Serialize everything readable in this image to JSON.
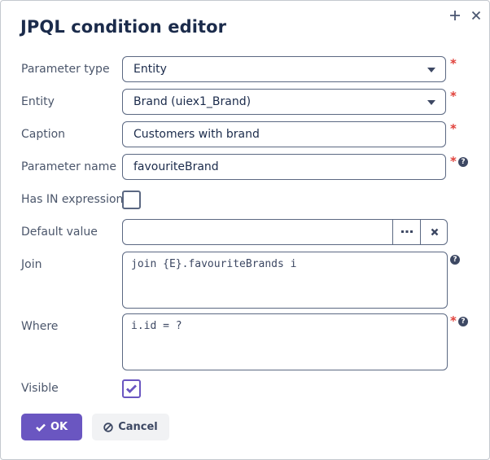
{
  "dialog": {
    "title": "JPQL condition editor",
    "maximize_icon": "plus-icon",
    "close_icon": "close-icon"
  },
  "form": {
    "parameter_type": {
      "label": "Parameter type",
      "value": "Entity",
      "required": true
    },
    "entity": {
      "label": "Entity",
      "value": "Brand (uiex1_Brand)",
      "required": true
    },
    "caption": {
      "label": "Caption",
      "value": "Customers with brand",
      "required": true
    },
    "parameter_name": {
      "label": "Parameter name",
      "value": "favouriteBrand",
      "required": true,
      "help": "?"
    },
    "has_in_expression": {
      "label": "Has IN expression",
      "checked": false
    },
    "default_value": {
      "label": "Default value",
      "value": "",
      "lookup_icon": "ellipsis-icon",
      "clear_icon": "clear-icon"
    },
    "join": {
      "label": "Join",
      "value": "join {E}.favouriteBrands i",
      "help": "?"
    },
    "where": {
      "label": "Where",
      "value": "i.id = ?",
      "required": true,
      "help": "?"
    },
    "visible": {
      "label": "Visible",
      "checked": true
    }
  },
  "required_mark": "*",
  "buttons": {
    "ok": {
      "label": "OK",
      "icon": "check-icon"
    },
    "cancel": {
      "label": "Cancel",
      "icon": "ban-icon"
    }
  },
  "colors": {
    "accent": "#6a56c1",
    "required": "#e0403a",
    "border": "#5b6882",
    "title": "#1b2b4b",
    "label": "#4b566b"
  }
}
